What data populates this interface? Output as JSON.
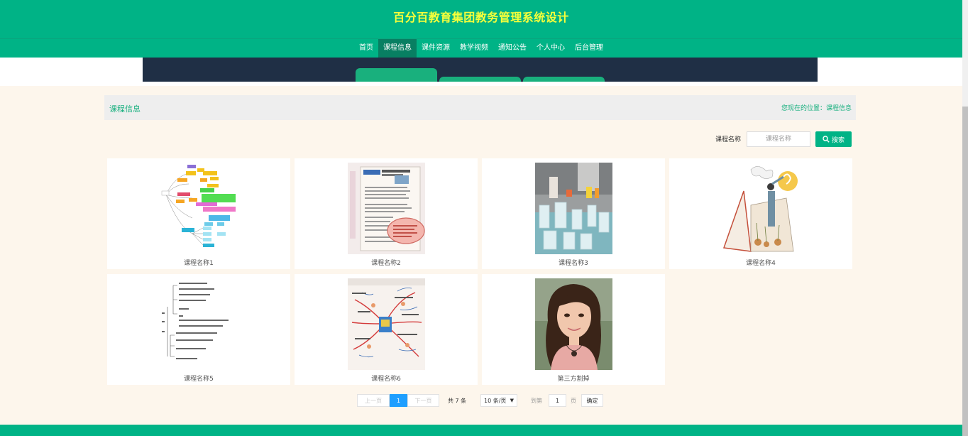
{
  "site_title": "百分百教育集团教务管理系统设计",
  "nav": [
    {
      "label": "首页",
      "active": false
    },
    {
      "label": "课程信息",
      "active": true
    },
    {
      "label": "课件资源",
      "active": false
    },
    {
      "label": "教学视频",
      "active": false
    },
    {
      "label": "通知公告",
      "active": false
    },
    {
      "label": "个人中心",
      "active": false
    },
    {
      "label": "后台管理",
      "active": false
    }
  ],
  "breadcrumb": {
    "title": "课程信息",
    "location": "您现在的位置：课程信息"
  },
  "search": {
    "label": "课程名称",
    "placeholder": "课程名称",
    "button": "搜索"
  },
  "courses": [
    {
      "title": "课程名称1",
      "image": "mind-map-colorful"
    },
    {
      "title": "课程名称2",
      "image": "english-textbook-page"
    },
    {
      "title": "课程名称3",
      "image": "laboratory-glassware"
    },
    {
      "title": "课程名称4",
      "image": "book-illustration"
    },
    {
      "title": "课程名称5",
      "image": "outline-diagram"
    },
    {
      "title": "课程名称6",
      "image": "hand-drawn-mind-map"
    },
    {
      "title": "第三方割掉",
      "image": "woman-portrait"
    }
  ],
  "pagination": {
    "prev": "上一页",
    "current": "1",
    "next": "下一页",
    "total": "共 7 条",
    "page_size": "10 条/页",
    "goto_label": "到第",
    "goto_value": "1",
    "page_unit": "页",
    "confirm": "确定"
  },
  "colors": {
    "primary": "#00b386",
    "title": "#f6ff3a",
    "active_nav": "#087f62",
    "page_bg": "#fdf6ec",
    "pager_active": "#1e9fff"
  }
}
